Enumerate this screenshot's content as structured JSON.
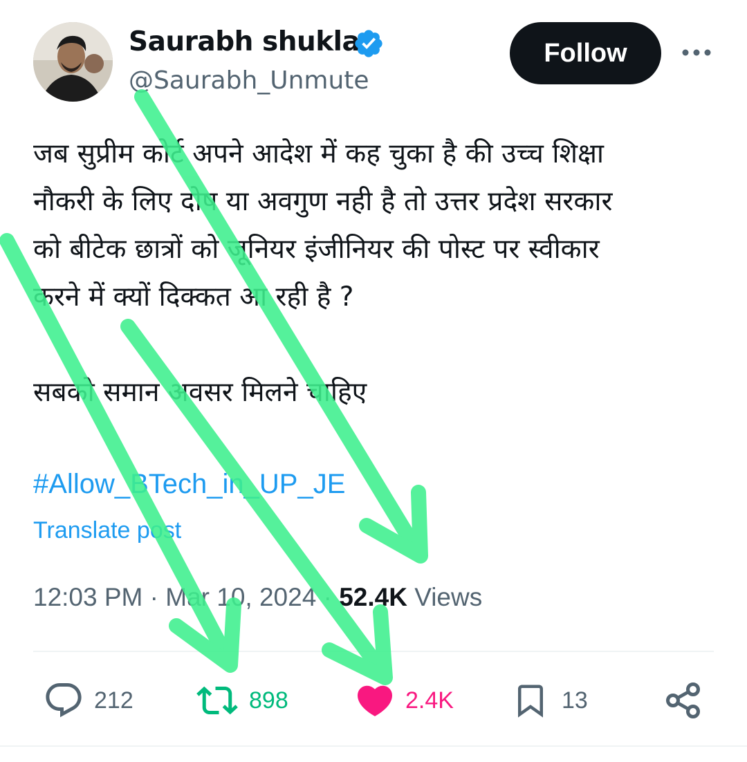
{
  "author": {
    "name": "Saurabh shukla",
    "handle": "@Saurabh_Unmute",
    "verified": true
  },
  "follow_button": "Follow",
  "post": {
    "lines": [
      "जब सुप्रीम कोर्ट अपने आदेश में कह चुका है की उच्च शिक्षा",
      "नौकरी के लिए दोष या अवगुण नही है तो उत्तर प्रदेश सरकार",
      "को बीटेक छात्रों को जूनियर इंजीनियर की पोस्ट पर स्वीकार",
      "करने में क्यों दिक्कत आ रही है ?"
    ],
    "second_paragraph": "सबको समान अवसर मिलने चाहिए",
    "hashtag": "#Allow_BTech_in_UP_JE",
    "translate": "Translate post"
  },
  "meta": {
    "time": "12:03 PM",
    "date": "Mar 10, 2024",
    "views_count": "52.4K",
    "views_label": "Views"
  },
  "actions": {
    "replies": "212",
    "reposts": "898",
    "likes": "2.4K",
    "bookmarks": "13"
  },
  "colors": {
    "accent": "#1d9bf0",
    "repost": "#00ba7c",
    "like": "#f91880",
    "muted": "#536471",
    "arrow": "#3ef08e"
  },
  "icons": [
    "verified-badge-icon",
    "more-icon",
    "reply-icon",
    "repost-icon",
    "heart-icon",
    "bookmark-icon",
    "share-icon"
  ]
}
